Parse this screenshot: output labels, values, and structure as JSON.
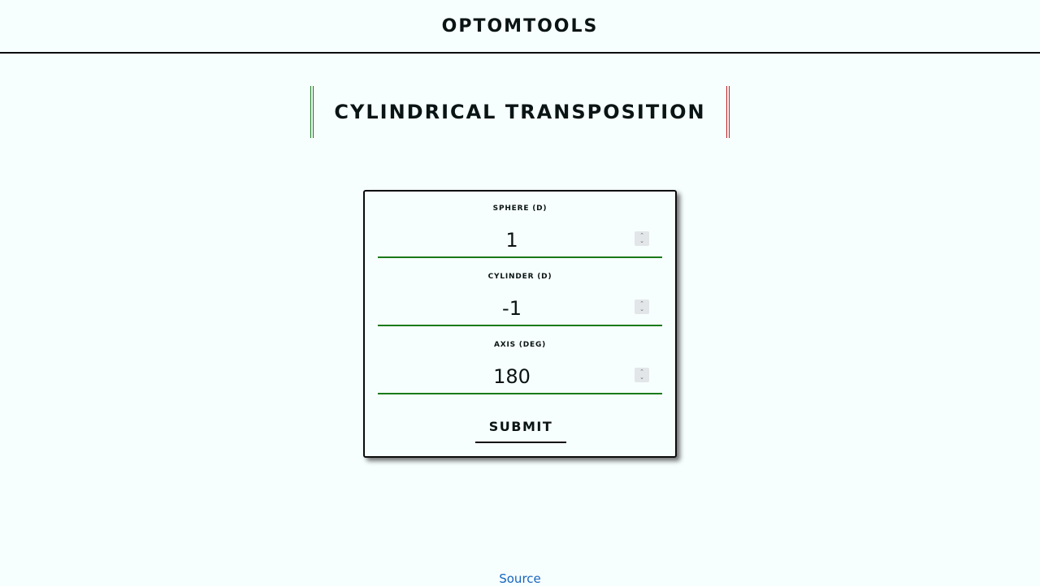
{
  "header": {
    "brand": "OPTOMTOOLS"
  },
  "page": {
    "title": "CYLINDRICAL TRANSPOSITION"
  },
  "form": {
    "fields": [
      {
        "label": "SPHERE (D)",
        "value": "1"
      },
      {
        "label": "CYLINDER (D)",
        "value": "-1"
      },
      {
        "label": "AXIS (DEG)",
        "value": "180"
      }
    ],
    "submit_label": "SUBMIT"
  },
  "footer": {
    "source_label": "Source"
  },
  "colors": {
    "background": "#f7fefe",
    "accent_green": "#1a7a1a",
    "accent_red": "#c02020",
    "link": "#1565c0"
  },
  "icons": {
    "spinner": "chevron-up-down-icon"
  }
}
